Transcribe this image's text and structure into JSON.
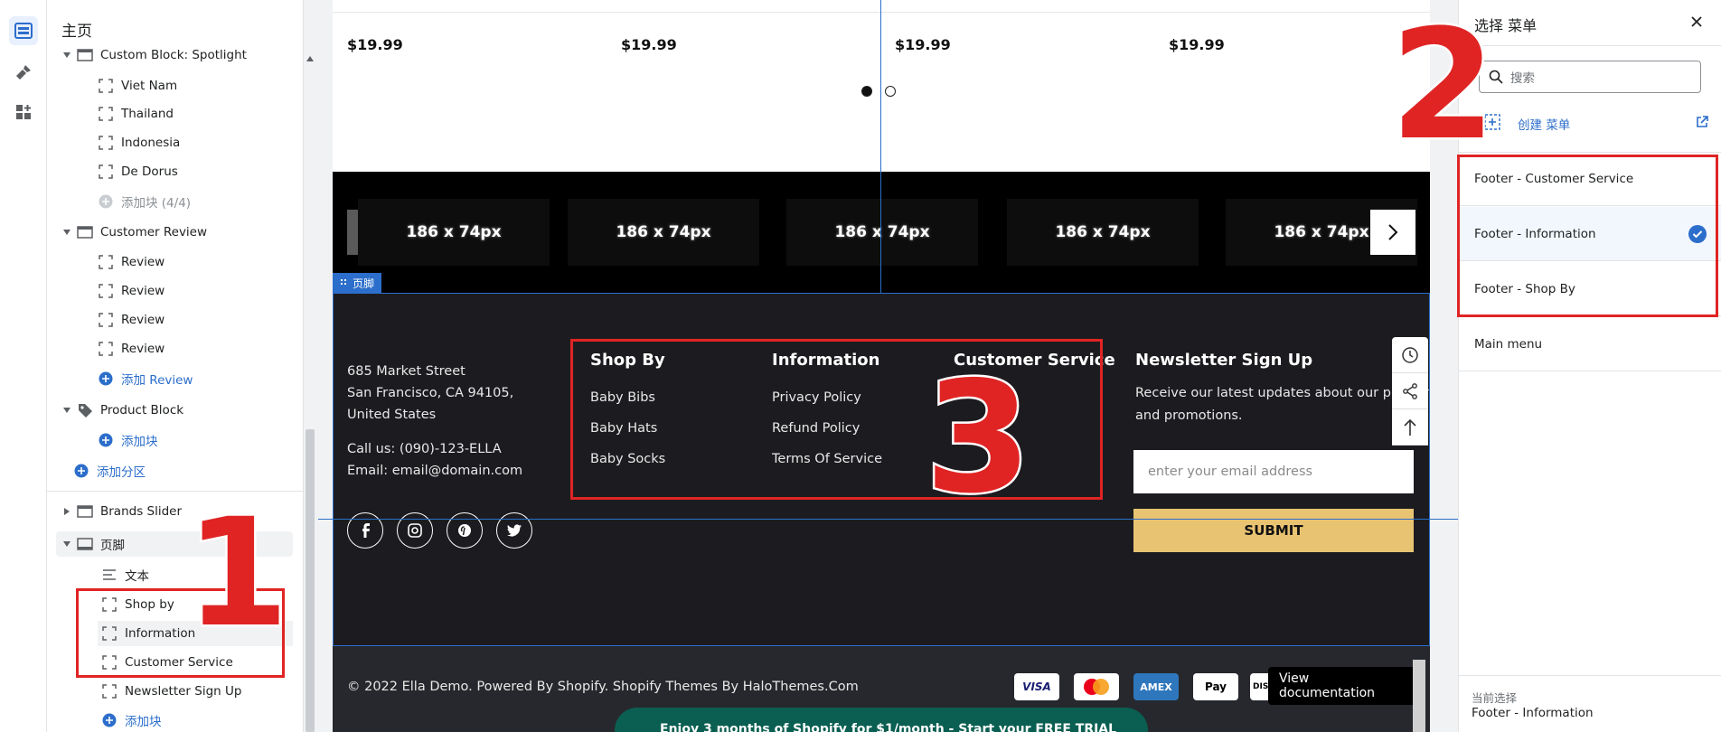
{
  "sidebar": {
    "home_title": "主页",
    "items": [
      {
        "label": "Custom Block: Spotlight"
      },
      {
        "label": "Viet Nam"
      },
      {
        "label": "Thailand"
      },
      {
        "label": "Indonesia"
      },
      {
        "label": "De Dorus"
      },
      {
        "label": "添加块 (4/4)"
      },
      {
        "label": "Customer Review"
      },
      {
        "label": "Review"
      },
      {
        "label": "Review"
      },
      {
        "label": "Review"
      },
      {
        "label": "Review"
      },
      {
        "label": "添加 Review"
      },
      {
        "label": "Product Block"
      },
      {
        "label": "添加块"
      },
      {
        "label": "添加分区"
      },
      {
        "label": "Brands Slider"
      },
      {
        "label": "页脚"
      },
      {
        "label": "文本"
      },
      {
        "label": "Shop by"
      },
      {
        "label": "Information"
      },
      {
        "label": "Customer Service"
      },
      {
        "label": "Newsletter Sign Up"
      },
      {
        "label": "添加块"
      }
    ]
  },
  "annotations": {
    "n1": "1",
    "n2": "2",
    "n3": "3"
  },
  "preview": {
    "prices": [
      "$19.99",
      "$19.99",
      "$19.99",
      "$19.99"
    ],
    "brands": [
      "186 x 74px",
      "186 x 74px",
      "186 x 74px",
      "186 x 74px",
      "186 x 74px"
    ],
    "footer_tag": "页脚",
    "address": [
      "685 Market Street",
      "San Francisco, CA 94105,",
      "United States"
    ],
    "call": "Call us: (090)-123-ELLA",
    "email_line": "Email: email@domain.com",
    "columns": [
      {
        "title": "Shop By",
        "links": [
          "Baby Bibs",
          "Baby Hats",
          "Baby Socks"
        ]
      },
      {
        "title": "Information",
        "links": [
          "Privacy Policy",
          "Refund Policy",
          "Terms Of Service"
        ]
      },
      {
        "title": "Customer Service",
        "links": []
      }
    ],
    "newsletter": {
      "title": "Newsletter Sign Up",
      "desc": [
        "Receive our latest updates about our products",
        "and promotions."
      ],
      "placeholder": "enter your email address",
      "submit": "SUBMIT"
    },
    "copyright": "© 2022 Ella Demo. Powered By Shopify. Shopify Themes By HaloThemes.Com",
    "payments": [
      "VISA",
      "",
      "AMEX",
      "Pay",
      "DISC"
    ],
    "view_doc": "View documentation",
    "promo": "Enjoy 3 months of Shopify for $1/month - Start your FREE TRIAL"
  },
  "right_panel": {
    "title": "选择 菜单",
    "search_placeholder": "搜索",
    "create_label": "创建 菜单",
    "menus": [
      {
        "label": "Footer - Customer Service",
        "selected": false
      },
      {
        "label": "Footer - Information",
        "selected": true
      },
      {
        "label": "Footer - Shop By",
        "selected": false
      },
      {
        "label": "Main menu",
        "selected": false
      }
    ],
    "current_label": "当前选择",
    "current_value": "Footer - Information"
  },
  "colors": {
    "accent": "#2c6ecb",
    "annotation": "#e02424",
    "submit": "#e8c372",
    "footer_bg": "#1c1c20"
  }
}
